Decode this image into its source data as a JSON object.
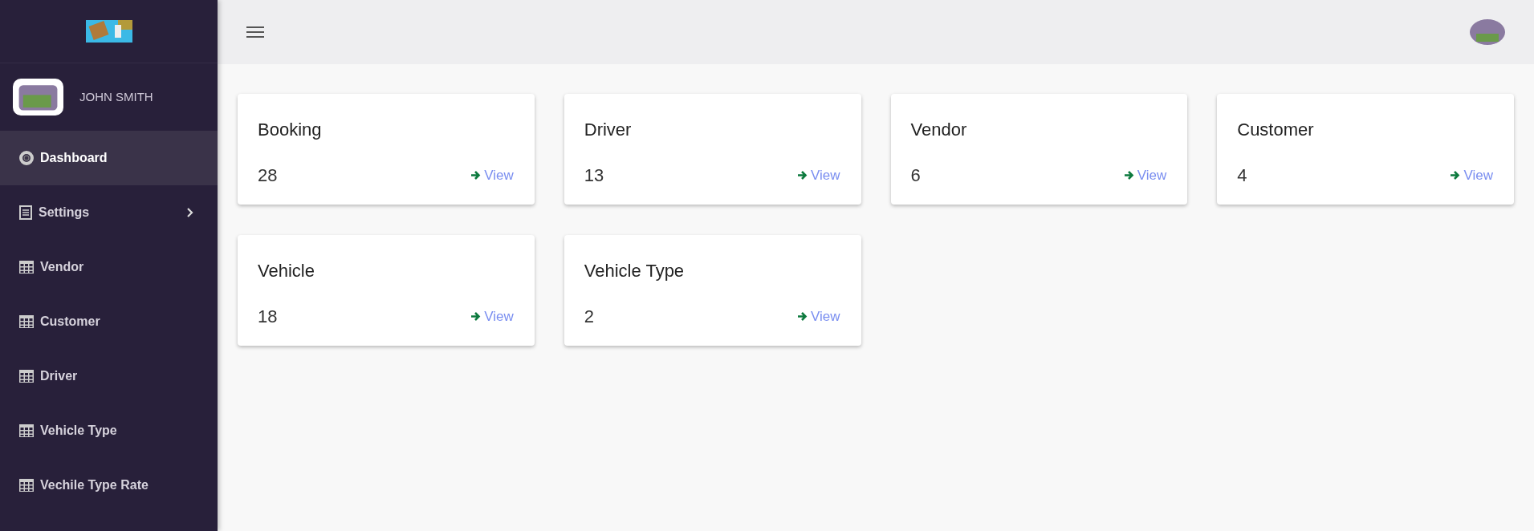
{
  "sidebar": {
    "user": {
      "name": "JOHN SMITH"
    },
    "items": [
      {
        "label": "Dashboard",
        "kind": "dashboard",
        "selected": true
      },
      {
        "label": "Settings",
        "kind": "settings",
        "selected": false,
        "expandable": true
      },
      {
        "label": "Vendor",
        "kind": "table",
        "selected": false
      },
      {
        "label": "Customer",
        "kind": "table",
        "selected": false
      },
      {
        "label": "Driver",
        "kind": "table",
        "selected": false
      },
      {
        "label": "Vehicle Type",
        "kind": "table",
        "selected": false
      },
      {
        "label": "Vechile Type Rate",
        "kind": "table",
        "selected": false
      }
    ]
  },
  "cards": [
    {
      "title": "Booking",
      "count": "28",
      "link": "View"
    },
    {
      "title": "Driver",
      "count": "13",
      "link": "View"
    },
    {
      "title": "Vendor",
      "count": "6",
      "link": "View"
    },
    {
      "title": "Customer",
      "count": "4",
      "link": "View"
    },
    {
      "title": "Vehicle",
      "count": "18",
      "link": "View"
    },
    {
      "title": "Vehicle Type",
      "count": "2",
      "link": "View"
    }
  ]
}
